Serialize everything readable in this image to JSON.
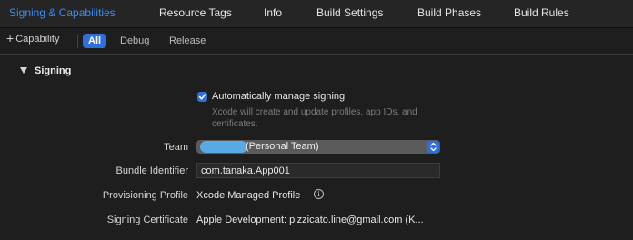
{
  "tabs": [
    {
      "label": "Signing & Capabilities",
      "active": true
    },
    {
      "label": "Resource Tags",
      "active": false
    },
    {
      "label": "Info",
      "active": false
    },
    {
      "label": "Build Settings",
      "active": false
    },
    {
      "label": "Build Phases",
      "active": false
    },
    {
      "label": "Build Rules",
      "active": false
    }
  ],
  "filterbar": {
    "add_capability": "Capability",
    "add_icon": "plus-icon",
    "segments": [
      {
        "label": "All",
        "selected": true
      },
      {
        "label": "Debug",
        "selected": false
      },
      {
        "label": "Release",
        "selected": false
      }
    ]
  },
  "signing": {
    "section_title": "Signing",
    "disclosure_icon": "disclosure-triangle-down-icon",
    "auto_manage": {
      "checked": true,
      "label": "Automatically manage signing",
      "hint": "Xcode will create and update profiles, app IDs, and certificates."
    },
    "team": {
      "label": "Team",
      "value": "(Personal Team)"
    },
    "bundle_identifier": {
      "label": "Bundle Identifier",
      "value": "com.tanaka.App001"
    },
    "provisioning_profile": {
      "label": "Provisioning Profile",
      "value": "Xcode Managed Profile",
      "icon": "info-icon"
    },
    "signing_certificate": {
      "label": "Signing Certificate",
      "value": "Apple Development: pizzicato.line@gmail.com (K..."
    }
  },
  "colors": {
    "accent": "#2f6fdc",
    "active_tab": "#3a8ef6",
    "background": "#1e1e1e",
    "redaction": "#59a9e7"
  }
}
